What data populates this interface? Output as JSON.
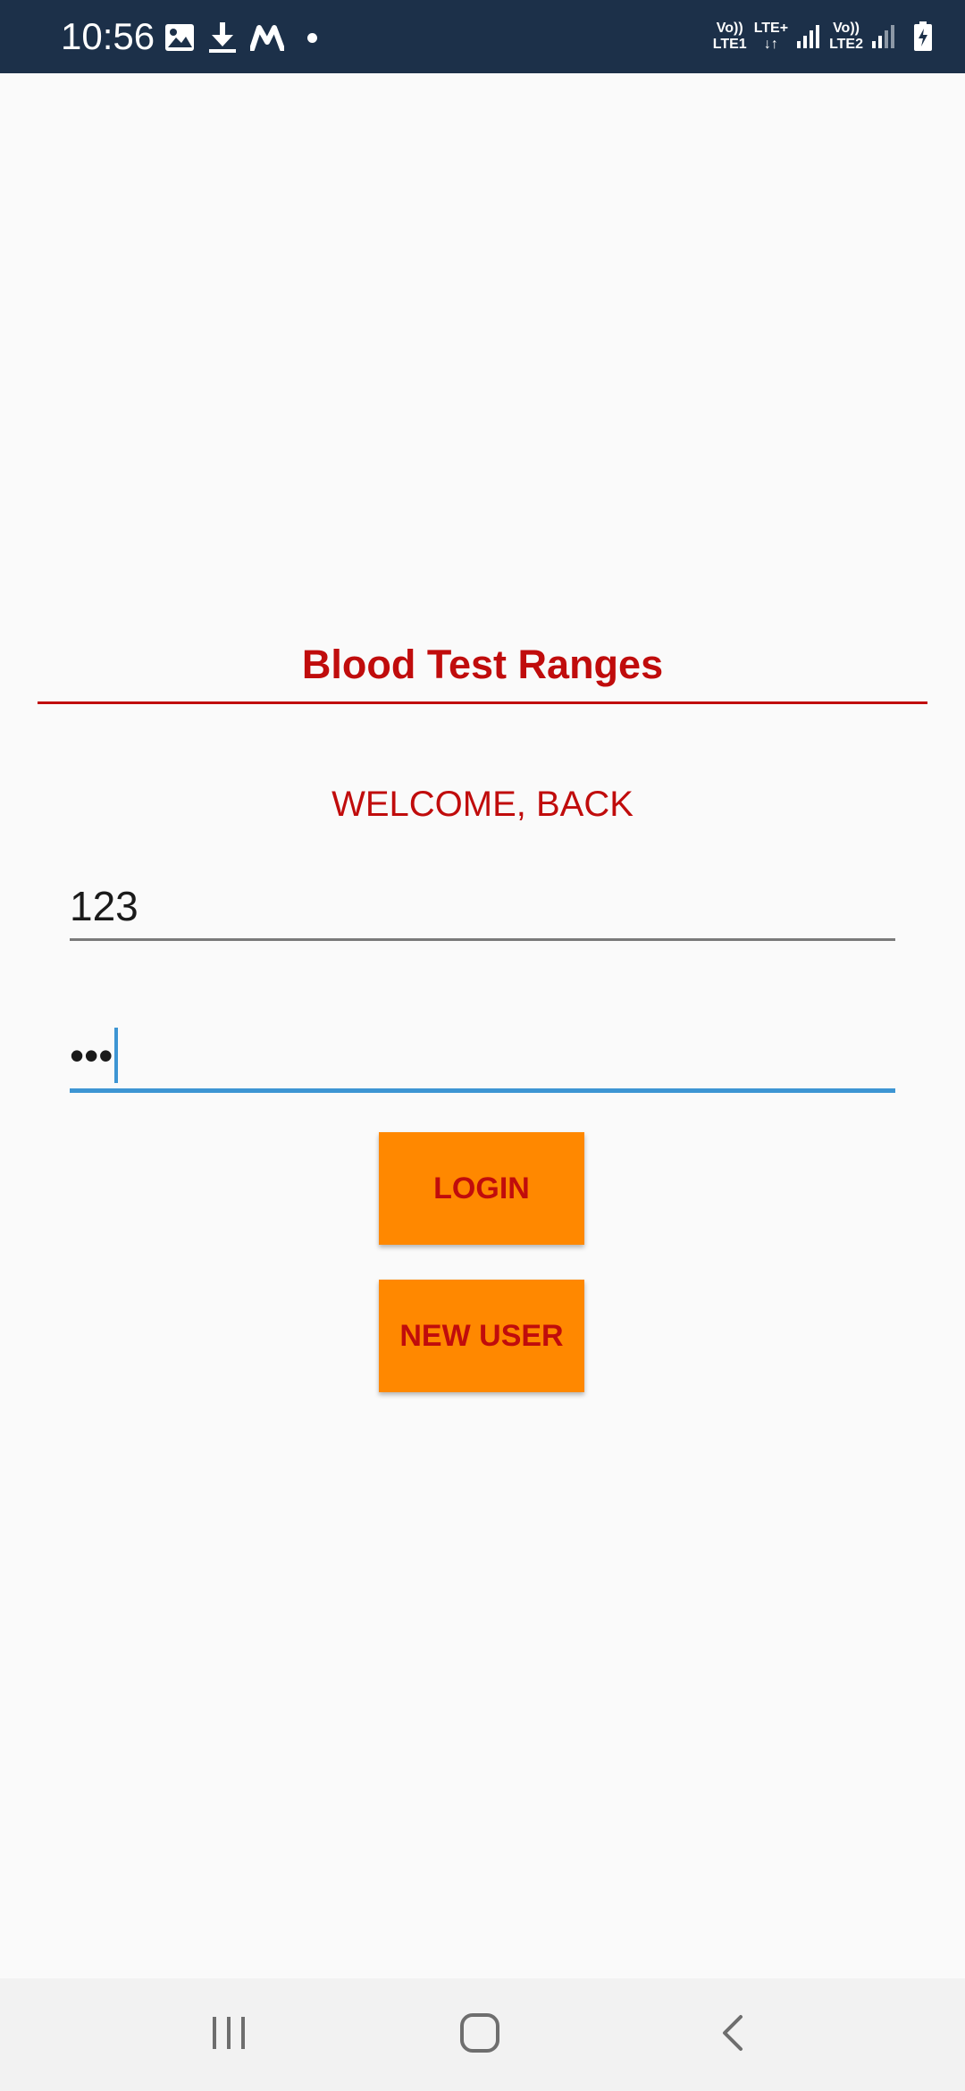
{
  "status_bar": {
    "time": "10:56",
    "left_icons": [
      "image-icon",
      "download-icon",
      "m-logo-icon",
      "notification-dot-icon"
    ],
    "network": [
      {
        "top": "Vo))",
        "bottom": "LTE1"
      },
      {
        "top": "LTE+",
        "bottom": "↓↑"
      },
      {
        "top": "Vo))",
        "bottom": "LTE2"
      }
    ],
    "right_icons": [
      "signal-strength-icon",
      "signal-strength-icon",
      "battery-charging-icon"
    ],
    "background_color": "#1c3049"
  },
  "app": {
    "title": "Blood Test Ranges",
    "welcome": "WELCOME, BACK",
    "accent_color": "#c00c0c"
  },
  "form": {
    "username_value": "123",
    "password_masked": "•••",
    "focused_field": "password",
    "focus_color": "#3d95d3"
  },
  "buttons": {
    "login_label": "LOGIN",
    "new_user_label": "NEW USER",
    "background_color": "#ff8800"
  },
  "nav_bar": {
    "items": [
      "recent-apps-icon",
      "home-icon",
      "back-icon"
    ]
  }
}
